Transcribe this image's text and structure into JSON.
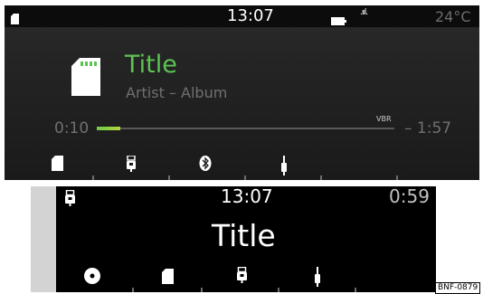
{
  "status_bar": {
    "time": "13:07",
    "signal": ".ııl.",
    "temperature": "24°C",
    "icons": [
      "sd-card-icon",
      "battery-icon",
      "signal-icon"
    ]
  },
  "now_playing": {
    "title": "Title",
    "subtitle": "Artist – Album",
    "source_icon": "sd-card-icon",
    "elapsed": "0:10",
    "remaining": "– 1:57",
    "bitrate_label": "VBR",
    "progress": 0.08
  },
  "sources": [
    "sd-card-icon",
    "usb-icon",
    "bluetooth-icon",
    "aux-icon"
  ],
  "cluster": {
    "time": "13:07",
    "remaining": "0:59",
    "title": "Title",
    "source_icon": "usb-icon",
    "sources": [
      "cd-icon",
      "sd-card-icon",
      "usb-icon",
      "aux-icon"
    ]
  },
  "image_code": "BNF-0879",
  "colors": {
    "accent": "#5cc452",
    "screen_bg": "#232323",
    "cluster_bg": "#000000",
    "muted_text": "#707070"
  }
}
